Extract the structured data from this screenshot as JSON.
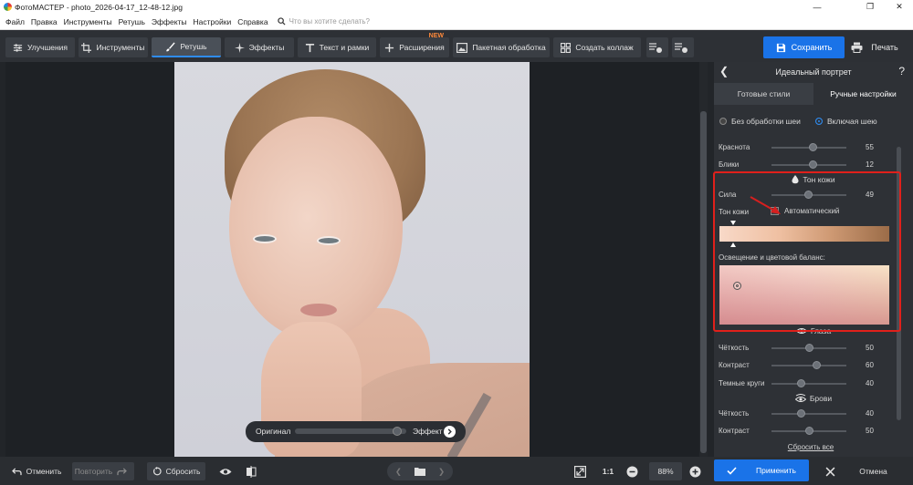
{
  "app": {
    "title": "ФотоМАСТЕР - photo_2026-04-17_12-48-12.jpg"
  },
  "menu": {
    "items": [
      "Файл",
      "Правка",
      "Инструменты",
      "Ретушь",
      "Эффекты",
      "Настройки",
      "Справка"
    ],
    "search_placeholder": "Что вы хотите сделать?"
  },
  "toolbar": {
    "tabs": [
      {
        "label": "Улучшения",
        "icon": "sliders-icon"
      },
      {
        "label": "Инструменты",
        "icon": "crop-icon"
      },
      {
        "label": "Ретушь",
        "icon": "brush-icon",
        "active": true
      },
      {
        "label": "Эффекты",
        "icon": "sparkle-icon"
      },
      {
        "label": "Текст и рамки",
        "icon": "text-icon"
      },
      {
        "label": "Расширения",
        "icon": "plus-icon",
        "badge": "NEW"
      },
      {
        "label": "Пакетная обработка",
        "icon": "image-icon"
      },
      {
        "label": "Создать коллаж",
        "icon": "grid-icon"
      }
    ],
    "save_label": "Сохранить",
    "print_label": "Печать"
  },
  "compare": {
    "left_label": "Оригинал",
    "right_label": "Эффект",
    "position": 0.92
  },
  "panel": {
    "title": "Идеальный портрет",
    "tabs": [
      "Готовые стили",
      "Ручные настройки"
    ],
    "active_tab": 1,
    "neck_options": [
      "Без обработки шеи",
      "Включая шею"
    ],
    "neck_selected": 1,
    "sliders_top": [
      {
        "label": "Краснота",
        "value": "55",
        "level": 0.55
      },
      {
        "label": "Блики",
        "value": "12",
        "level": 0.55
      }
    ],
    "skin_section_title": "Тон кожи",
    "skin_strength": {
      "label": "Сила",
      "value": "49",
      "level": 0.49
    },
    "skin_tone_label": "Тон кожи",
    "auto_label": "Автоматический",
    "lighting_label": "Освещение и цветовой баланс:",
    "eyes_section_title": "Глаза",
    "eyes_sliders": [
      {
        "label": "Чёткость",
        "value": "50",
        "level": 0.5
      },
      {
        "label": "Контраст",
        "value": "60",
        "level": 0.6
      },
      {
        "label": "Темные круги",
        "value": "40",
        "level": 0.4
      }
    ],
    "brows_section_title": "Брови",
    "brows_sliders": [
      {
        "label": "Чёткость",
        "value": "40",
        "level": 0.4
      },
      {
        "label": "Контраст",
        "value": "50",
        "level": 0.5
      }
    ],
    "reset_all": "Сбросить все"
  },
  "bottom": {
    "undo": "Отменить",
    "redo": "Повторить",
    "reset": "Сбросить",
    "zoom_ratio": "1:1",
    "zoom_percent": "88%",
    "apply": "Применить",
    "cancel": "Отмена"
  },
  "colors": {
    "accent": "#1a73e8",
    "highlight_box": "#e0201b",
    "arrow": "#d61f1f"
  }
}
